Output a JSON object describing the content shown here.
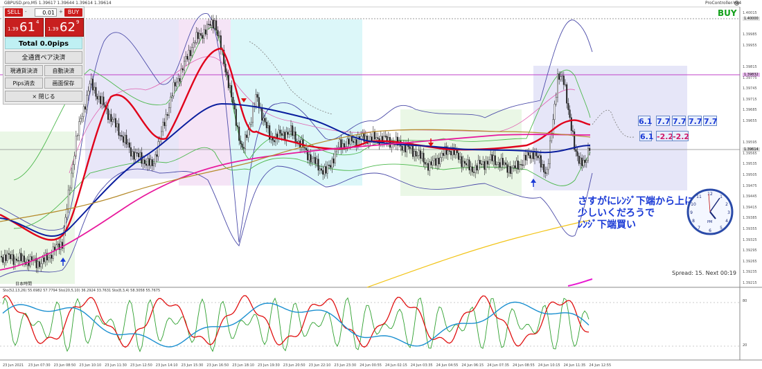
{
  "header": {
    "symbol_info": "GBPUSD.pro,M5  1.39617 1.39644 1.39614 1.39614",
    "top_right_label": "ProController-V34",
    "signal": "BUY",
    "jp_time_label": "日本時間",
    "subwindow_label": "Sto(52,13,26) 55.6982 57.7794  Sto(20,5,10) 36.2924 33.7631  Sto(8,3,4) 58.3058 55.7675",
    "spread_info": "Spread: 15. Next 00:19"
  },
  "panel": {
    "sell_label": "SELL",
    "buy_label": "BUY",
    "lot_value": "0.01",
    "sell_price": {
      "prefix": "1.39",
      "big": "61",
      "sup": "4"
    },
    "buy_price": {
      "prefix": "1.39",
      "big": "62",
      "sup": "9"
    },
    "total_label": "Total   0.0pips",
    "close_all_pairs": "全通貨ペア決済",
    "close_current": "現通貨決済",
    "auto_close": "自動決済",
    "pips_clear": "Pips消去",
    "save_screen": "画面保存",
    "close_panel": "× 閉じる"
  },
  "annotation": {
    "line1": "さすがにﾚﾝｼﾞ下端から上に",
    "line2": "少しいくだろうで",
    "line3": "ﾚﾝｼﾞ下端買い",
    "color": "#1a3ad6"
  },
  "tags": {
    "row1": [
      "6.1",
      "7.7",
      "7.7",
      "7.7",
      "7.7"
    ],
    "row2": [
      "6.1",
      "-2.2",
      "-2.2"
    ]
  },
  "clock": {
    "label": "PM"
  },
  "price_axis": {
    "labels": [
      "1.40015",
      "1.40000",
      "1.39985",
      "1.39955",
      "1.39832",
      "1.39815",
      "1.39775",
      "1.39745",
      "1.39715",
      "1.39685",
      "1.39655",
      "1.39614",
      "1.39595",
      "1.39565",
      "1.39535",
      "1.39505",
      "1.39475",
      "1.39445",
      "1.39415",
      "1.39385",
      "1.39355",
      "1.39325",
      "1.39295",
      "1.39265",
      "1.39235",
      "1.39215"
    ],
    "highlight_current": "1.39614",
    "highlight_line": "1.39832",
    "highlight_top": "1.40000"
  },
  "sub_axis": [
    "80",
    "20"
  ],
  "time_axis": [
    "23 Jun 2021",
    "23 Jun 07:30",
    "23 Jun 08:50",
    "23 Jun 10:10",
    "23 Jun 11:30",
    "23 Jun 12:50",
    "23 Jun 14:10",
    "23 Jun 15:30",
    "23 Jun 16:50",
    "23 Jun 18:10",
    "23 Jun 19:30",
    "23 Jun 20:50",
    "23 Jun 22:10",
    "23 Jun 23:30",
    "24 Jun 00:55",
    "24 Jun 02:15",
    "24 Jun 03:35",
    "24 Jun 04:55",
    "24 Jun 06:15",
    "24 Jun 07:35",
    "24 Jun 08:55",
    "24 Jun 10:15",
    "24 Jun 11:35",
    "24 Jun 12:55"
  ],
  "colors": {
    "sell": "#c81f1f",
    "fast_ma": "#e0001a",
    "slow_ma": "#0a1e9e",
    "long_ma": "#e8189c",
    "band": "#3a3ab0",
    "stoch_fast": "#e01010",
    "stoch_slow": "#1a8fd0",
    "stoch_green": "#2ea02e",
    "yellow_ma": "#f2c418"
  }
}
